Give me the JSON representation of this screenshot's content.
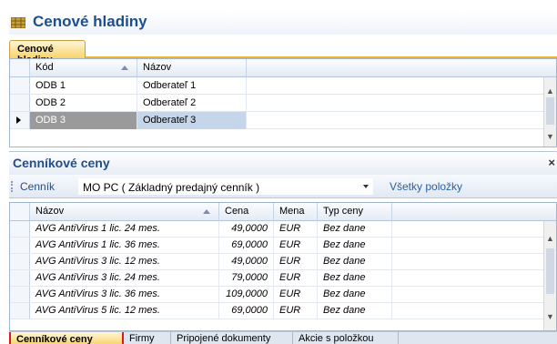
{
  "window": {
    "title": "Cenové hladiny",
    "icon": "table-grid-icon"
  },
  "top_tabs": [
    {
      "label": "Cenové hladiny",
      "active": true
    }
  ],
  "grid1": {
    "columns": [
      "Kód",
      "Názov"
    ],
    "rows": [
      {
        "kod": "ODB 1",
        "nazov": "Odberateľ 1",
        "selected": false
      },
      {
        "kod": "ODB 2",
        "nazov": "Odberateľ 2",
        "selected": false
      },
      {
        "kod": "ODB 3",
        "nazov": "Odberateľ 3",
        "selected": true
      }
    ]
  },
  "section2": {
    "title": "Cenníkové ceny",
    "close": "×"
  },
  "toolbar": {
    "label": "Cenník",
    "combo_value": "MO PC ( Základný predajný cenník )",
    "link": "Všetky položky"
  },
  "grid2": {
    "columns": [
      "Názov",
      "Cena",
      "Mena",
      "Typ ceny"
    ],
    "rows": [
      {
        "nazov": "AVG AntiVirus 1 lic. 24 mes.",
        "cena": "49,0000",
        "mena": "EUR",
        "typ": "Bez dane"
      },
      {
        "nazov": "AVG AntiVirus 1 lic. 36 mes.",
        "cena": "69,0000",
        "mena": "EUR",
        "typ": "Bez dane"
      },
      {
        "nazov": "AVG AntiVirus 3 lic. 12 mes.",
        "cena": "49,0000",
        "mena": "EUR",
        "typ": "Bez dane"
      },
      {
        "nazov": "AVG AntiVirus 3 lic. 24 mes.",
        "cena": "79,0000",
        "mena": "EUR",
        "typ": "Bez dane"
      },
      {
        "nazov": "AVG AntiVirus 3 lic. 36 mes.",
        "cena": "109,0000",
        "mena": "EUR",
        "typ": "Bez dane"
      },
      {
        "nazov": "AVG AntiVirus 5 lic. 12 mes.",
        "cena": "69,0000",
        "mena": "EUR",
        "typ": "Bez dane"
      }
    ]
  },
  "bottom_tabs": [
    {
      "label": "Cenníkové ceny",
      "active": true
    },
    {
      "label": "Firmy",
      "active": false
    },
    {
      "label": "Pripojené dokumenty",
      "active": false
    },
    {
      "label": "Akcie s položkou",
      "active": false
    }
  ],
  "colors": {
    "title_blue": "#1f4e8c",
    "active_tab": "#f7d36a",
    "highlight_border": "#e01818",
    "selected_row": "#9a9a9a"
  }
}
